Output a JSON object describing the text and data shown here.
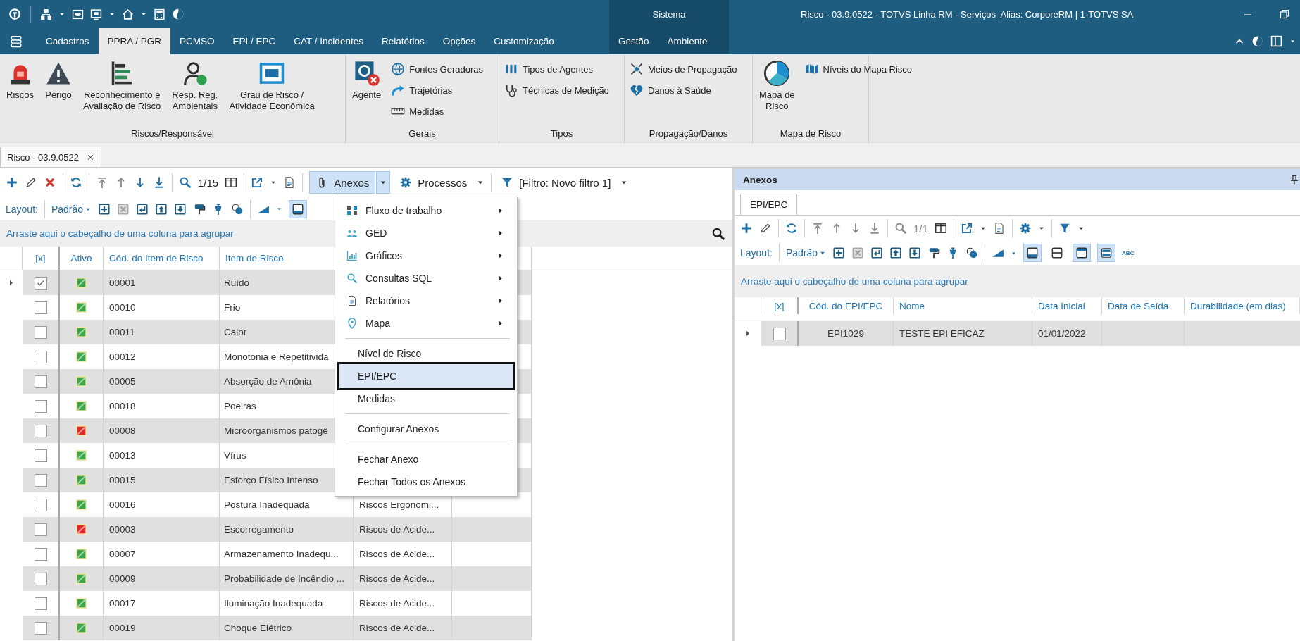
{
  "title_bar": {
    "context_title": "Sistema",
    "title": "Risco - 03.9.0522 - TOTVS Linha RM - Serviços  Alias: CorporeRM | 1-TOTVS SA"
  },
  "menu_tabs": [
    {
      "label": "Cadastros",
      "selected": false
    },
    {
      "label": "PPRA / PGR",
      "selected": true
    },
    {
      "label": "PCMSO",
      "selected": false
    },
    {
      "label": "EPI / EPC",
      "selected": false
    },
    {
      "label": "CAT / Incidentes",
      "selected": false
    },
    {
      "label": "Relatórios",
      "selected": false
    },
    {
      "label": "Opções",
      "selected": false
    },
    {
      "label": "Customização",
      "selected": false
    }
  ],
  "context_tabs": [
    {
      "label": "Gestão",
      "selected": false
    },
    {
      "label": "Ambiente",
      "selected": false
    }
  ],
  "ribbon": {
    "groups": [
      {
        "label": "Riscos/Responsável",
        "items": [
          {
            "kind": "large",
            "label": "Riscos"
          },
          {
            "kind": "large",
            "label": "Perigo"
          },
          {
            "kind": "large",
            "label": "Reconhecimento e\nAvaliação de Risco"
          },
          {
            "kind": "large",
            "label": "Resp. Reg.\nAmbientais"
          },
          {
            "kind": "large",
            "label": "Grau de Risco /\nAtividade Econômica"
          }
        ]
      },
      {
        "label": "Gerais",
        "items": [
          {
            "kind": "large",
            "label": "Agente"
          },
          {
            "kind": "small",
            "label": "Fontes Geradoras"
          },
          {
            "kind": "small",
            "label": "Trajetórias"
          },
          {
            "kind": "small",
            "label": "Medidas"
          }
        ]
      },
      {
        "label": "Tipos",
        "items": [
          {
            "kind": "small",
            "label": "Tipos de Agentes"
          },
          {
            "kind": "small",
            "label": "Técnicas de Medição"
          }
        ]
      },
      {
        "label": "Propagação/Danos",
        "items": [
          {
            "kind": "small",
            "label": "Meios de Propagação"
          },
          {
            "kind": "small",
            "label": "Danos à Saúde"
          }
        ]
      },
      {
        "label": "Mapa de Risco",
        "items": [
          {
            "kind": "large",
            "label": "Mapa de\nRisco"
          },
          {
            "kind": "small",
            "label": "Níveis do Mapa Risco"
          }
        ]
      }
    ]
  },
  "document_tabs": [
    {
      "label": "Risco - 03.9.0522",
      "selected": true
    }
  ],
  "main_view": {
    "toolbar": {
      "record_counter": {
        "text": "1/15",
        "disabled": false
      },
      "attachments_button": {
        "label": "Anexos",
        "expanded": true
      },
      "processes_button": {
        "label": "Processos"
      },
      "filter_button": {
        "label": "[Filtro: Novo filtro 1]"
      }
    },
    "layout_bar": {
      "label": "Layout:",
      "preset": "Padrão",
      "view_toggles": [
        {
          "pressed": true
        }
      ]
    },
    "group_hint": "Arraste aqui o cabeçalho de uma coluna para agrupar",
    "table": {
      "columns": [
        "[x]",
        "Ativo",
        "Cód. do Item de Risco",
        "Item de Risco"
      ],
      "rows": [
        {
          "selected": true,
          "checked": true,
          "active": true,
          "code": "00001",
          "item": "Ruído"
        },
        {
          "selected": false,
          "checked": false,
          "active": true,
          "code": "00010",
          "item": "Frio"
        },
        {
          "selected": false,
          "checked": false,
          "active": true,
          "code": "00011",
          "item": "Calor"
        },
        {
          "selected": false,
          "checked": false,
          "active": true,
          "code": "00012",
          "item": "Monotonia e Repetitivida"
        },
        {
          "selected": false,
          "checked": false,
          "active": true,
          "code": "00005",
          "item": "Absorção de Amônia"
        },
        {
          "selected": false,
          "checked": false,
          "active": true,
          "code": "00018",
          "item": "Poeiras"
        },
        {
          "selected": false,
          "checked": false,
          "active": false,
          "code": "00008",
          "item": "Microorganismos patogê"
        },
        {
          "selected": false,
          "checked": false,
          "active": true,
          "code": "00013",
          "item": "Vírus"
        },
        {
          "selected": false,
          "checked": false,
          "active": true,
          "code": "00015",
          "item": "Esforço Físico Intenso"
        },
        {
          "selected": false,
          "checked": false,
          "active": true,
          "code": "00016",
          "item": "Postura Inadequada",
          "column_5": "Riscos Ergonomi..."
        },
        {
          "selected": false,
          "checked": false,
          "active": false,
          "code": "00003",
          "item": "Escorregamento",
          "column_5": "Riscos de Acide..."
        },
        {
          "selected": false,
          "checked": false,
          "active": true,
          "code": "00007",
          "item": "Armazenamento Inadequ...",
          "column_5": "Riscos de Acide..."
        },
        {
          "selected": false,
          "checked": false,
          "active": true,
          "code": "00009",
          "item": "Probabilidade de Incêndio ...",
          "column_5": "Riscos de Acide..."
        },
        {
          "selected": false,
          "checked": false,
          "active": true,
          "code": "00017",
          "item": "Iluminação Inadequada",
          "column_5": "Riscos de Acide..."
        },
        {
          "selected": false,
          "checked": false,
          "active": true,
          "code": "00019",
          "item": "Choque Elétrico",
          "column_5": "Riscos de Acide..."
        }
      ]
    }
  },
  "attachments_menu": {
    "items": [
      {
        "kind": "submenu",
        "label": "Fluxo de trabalho",
        "selected": false
      },
      {
        "kind": "submenu",
        "label": "GED",
        "selected": false
      },
      {
        "kind": "submenu",
        "label": "Gráficos",
        "selected": false
      },
      {
        "kind": "submenu",
        "label": "Consultas SQL",
        "selected": false
      },
      {
        "kind": "submenu",
        "label": "Relatórios",
        "selected": false
      },
      {
        "kind": "submenu",
        "label": "Mapa",
        "selected": false
      },
      {
        "kind": "separator"
      },
      {
        "kind": "item",
        "label": "Nível de Risco",
        "selected": false
      },
      {
        "kind": "item",
        "label": "EPI/EPC",
        "selected": true
      },
      {
        "kind": "item",
        "label": "Medidas",
        "selected": false
      },
      {
        "kind": "separator"
      },
      {
        "kind": "item",
        "label": "Configurar Anexos",
        "selected": false
      },
      {
        "kind": "separator"
      },
      {
        "kind": "item",
        "label": "Fechar Anexo",
        "selected": false
      },
      {
        "kind": "item",
        "label": "Fechar Todos os Anexos",
        "selected": false
      }
    ]
  },
  "attachments_panel": {
    "title": "Anexos",
    "tabs": [
      {
        "label": "EPI/EPC",
        "selected": true
      }
    ],
    "toolbar": {
      "record_counter": {
        "text": "1/1",
        "disabled": true
      }
    },
    "layout_bar": {
      "label": "Layout:",
      "preset": "Padrão",
      "view_toggles": [
        {
          "pressed": true
        },
        {
          "pressed": false
        },
        {
          "pressed": true
        },
        {
          "pressed": true
        }
      ],
      "spellcheck_label": "ABC"
    },
    "group_hint": "Arraste aqui o cabeçalho de uma coluna para agrupar",
    "table": {
      "columns": [
        "[x]",
        "Cód. do EPI/EPC",
        "Nome",
        "Data Inicial",
        "Data de Saída",
        "Durabilidade (em dias)"
      ],
      "rows": [
        {
          "selected": true,
          "checked": false,
          "code": "EPI1029",
          "name": "TESTE EPI EFICAZ",
          "start_date": "01/01/2022"
        }
      ]
    }
  }
}
